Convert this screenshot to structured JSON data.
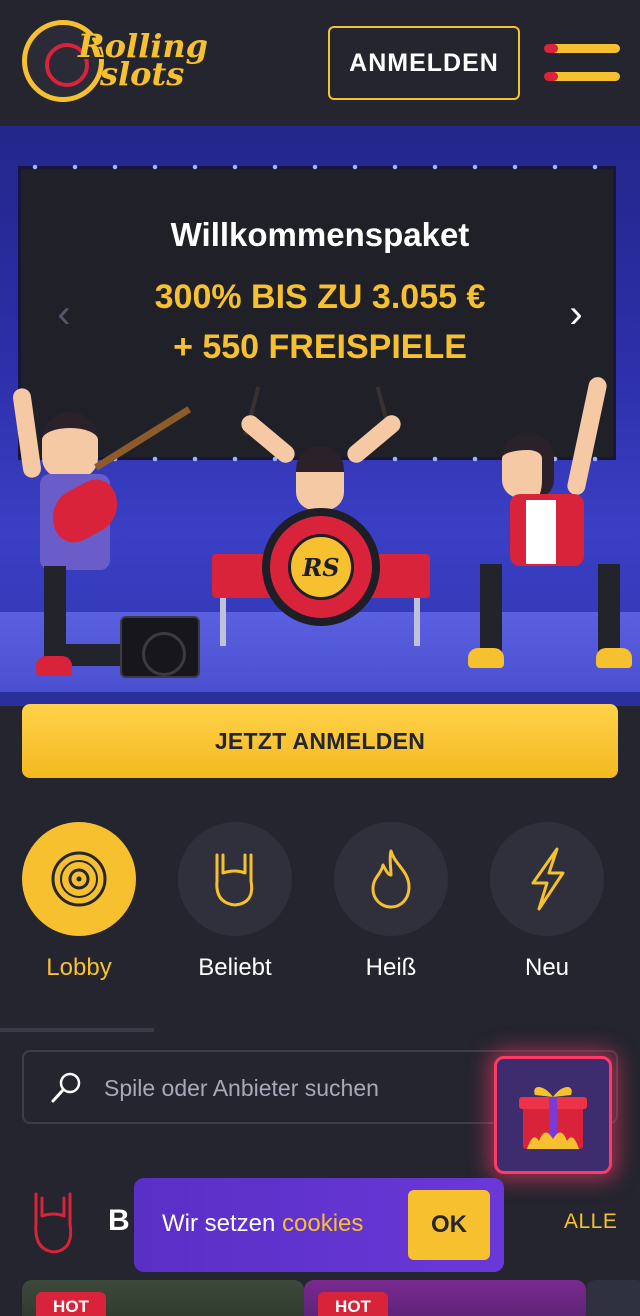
{
  "header": {
    "logo_text_line1": "Rolling",
    "logo_text_line2": "slots",
    "login_button": "ANMELDEN"
  },
  "hero": {
    "title": "Willkommenspaket",
    "offer_line1": "300% BIS ZU 3.055 €",
    "offer_line2": "+ 550 FREISPIELE",
    "drum_logo": "RS",
    "cta_button": "JETZT ANMELDEN"
  },
  "categories": [
    {
      "label": "Lobby",
      "icon": "vinyl-record-icon",
      "active": true
    },
    {
      "label": "Beliebt",
      "icon": "rock-hand-icon",
      "active": false
    },
    {
      "label": "Heiß",
      "icon": "flame-icon",
      "active": false
    },
    {
      "label": "Neu",
      "icon": "lightning-icon",
      "active": false
    }
  ],
  "search": {
    "placeholder": "Spile oder Anbieter suchen",
    "value": ""
  },
  "section": {
    "title_partial": "B",
    "all_link": "ALLE"
  },
  "cookie_banner": {
    "text_prefix": "Wir setzen ",
    "text_link": "cookies",
    "ok_button": "OK"
  },
  "game_tiles": [
    {
      "badge": "HOT"
    },
    {
      "badge": "HOT"
    }
  ],
  "colors": {
    "background": "#24252f",
    "accent_yellow": "#f6c02e",
    "accent_red": "#d8233a",
    "cookie_purple": "#5a2fc6",
    "hero_blue": "#2c2fa8"
  }
}
